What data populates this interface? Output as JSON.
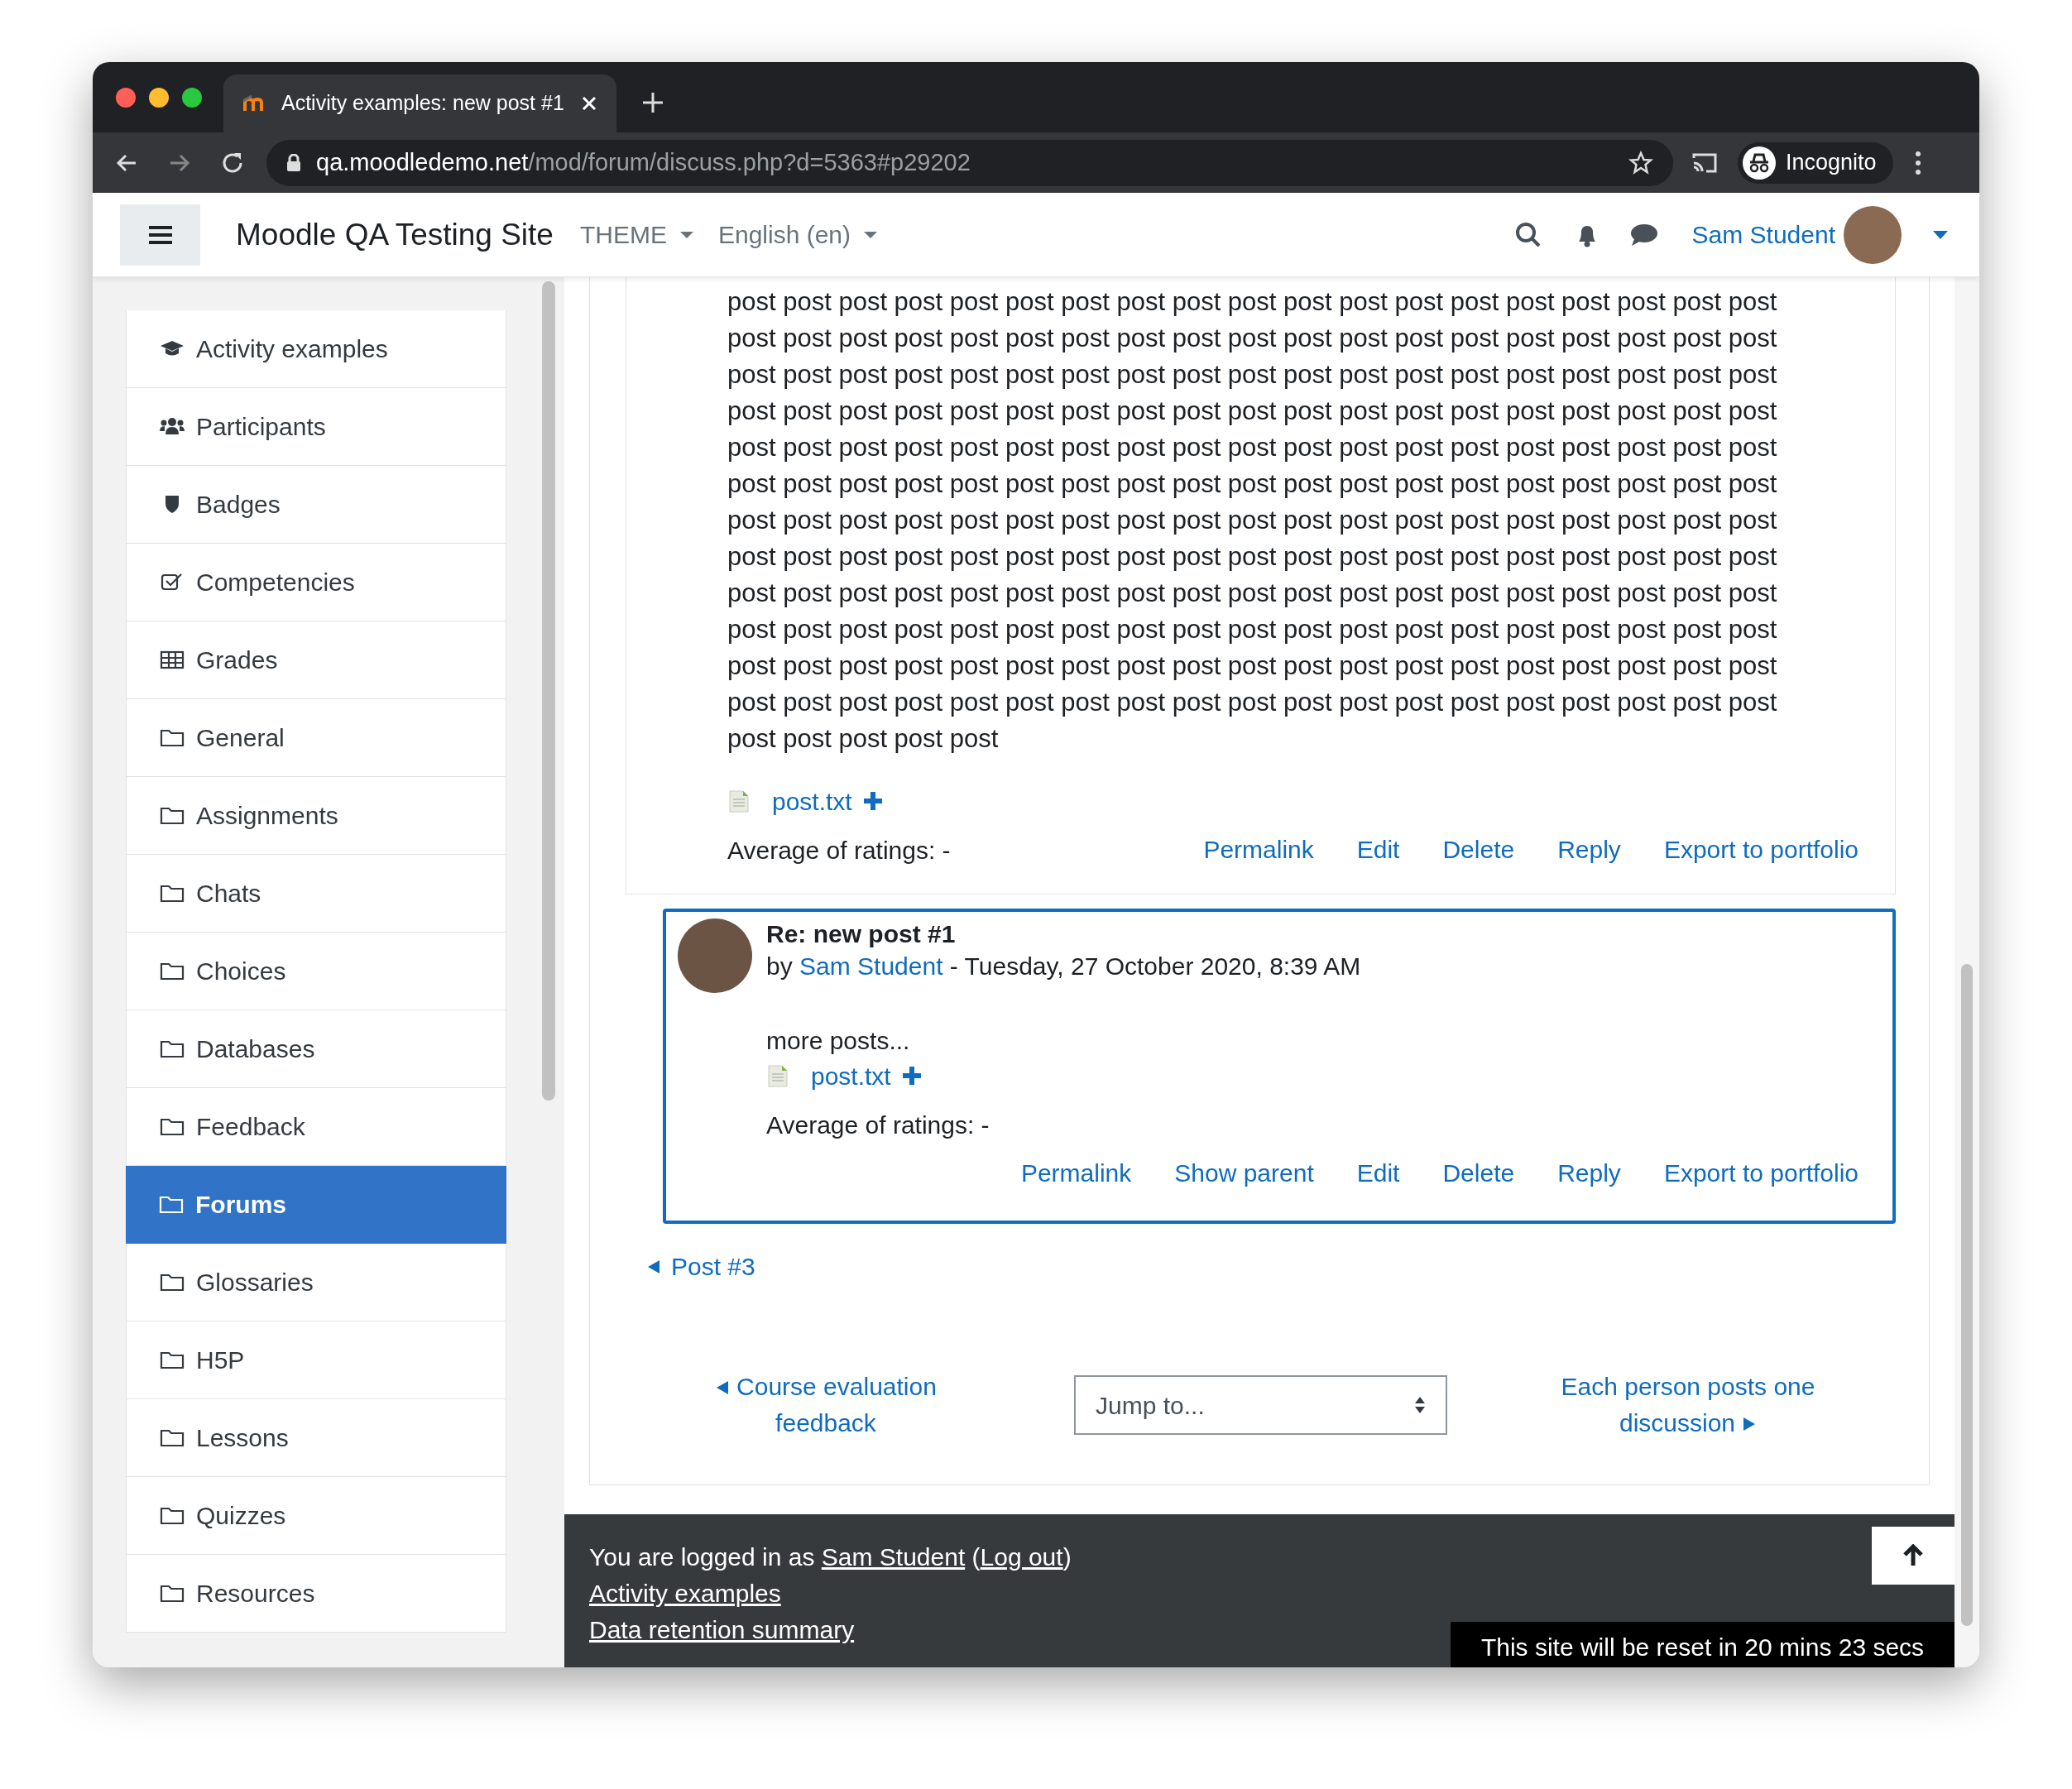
{
  "browser": {
    "tab_title": "Activity examples: new post #1",
    "url_host": "qa.moodledemo.net",
    "url_path": "/mod/forum/discuss.php?d=5363#p29202",
    "profile_label": "Incognito"
  },
  "navbar": {
    "site_name": "Moodle QA Testing Site",
    "menus": [
      "THEME",
      "English (en)"
    ],
    "user_name": "Sam Student"
  },
  "sidebar": {
    "items": [
      {
        "label": "Activity examples",
        "kind": "cap",
        "selected": false
      },
      {
        "label": "Participants",
        "kind": "users",
        "selected": false
      },
      {
        "label": "Badges",
        "kind": "shield",
        "selected": false
      },
      {
        "label": "Competencies",
        "kind": "check",
        "selected": false
      },
      {
        "label": "Grades",
        "kind": "table",
        "selected": false
      },
      {
        "label": "General",
        "kind": "folder",
        "selected": false
      },
      {
        "label": "Assignments",
        "kind": "folder",
        "selected": false
      },
      {
        "label": "Chats",
        "kind": "folder",
        "selected": false
      },
      {
        "label": "Choices",
        "kind": "folder",
        "selected": false
      },
      {
        "label": "Databases",
        "kind": "folder",
        "selected": false
      },
      {
        "label": "Feedback",
        "kind": "folder",
        "selected": false
      },
      {
        "label": "Forums",
        "kind": "folder",
        "selected": true
      },
      {
        "label": "Glossaries",
        "kind": "folder",
        "selected": false
      },
      {
        "label": "H5P",
        "kind": "folder",
        "selected": false
      },
      {
        "label": "Lessons",
        "kind": "folder",
        "selected": false
      },
      {
        "label": "Quizzes",
        "kind": "folder",
        "selected": false
      },
      {
        "label": "Resources",
        "kind": "folder",
        "selected": false
      }
    ]
  },
  "post": {
    "body": "post post post post post post post post post post post post post post post post post post post post post post post post post post post post post post post post post post post post post post post post post post post post post post post post post post post post post post post post post post post post post post post post post post post post post post post post post post post post post post post post post post post post post post post post post post post post post post post post post post post post post post post post post post post post post post post post post post post post post post post post post post post post post post post post post post post post post post post post post post post post post post post post post post post post post post post post post post post post post post post post post post post post post post post post post post post post post post post post post post post post post post post post post post post post post post post post post post post post post post post post post post post post post post post post post post post post post post post post post post post post post post post post post post post post post post post post post",
    "attachment": "post.txt",
    "rating": "Average of ratings: -",
    "actions": [
      "Permalink",
      "Edit",
      "Delete",
      "Reply",
      "Export to portfolio"
    ]
  },
  "reply": {
    "title": "Re: new post #1",
    "by": "by",
    "author": "Sam Student",
    "date": "- Tuesday, 27 October 2020, 8:39 AM",
    "body": "more posts...",
    "attachment": "post.txt",
    "rating": "Average of ratings: -",
    "actions": [
      "Permalink",
      "Show parent",
      "Edit",
      "Delete",
      "Reply",
      "Export to portfolio"
    ]
  },
  "discussion_nav": {
    "prev_post": "Post #3",
    "prev_discussion": "Course evaluation feedback",
    "jump_placeholder": "Jump to...",
    "next_discussion": "Each person posts one discussion"
  },
  "footer": {
    "prefix": "You are logged in as",
    "user": "Sam Student",
    "open_paren": "(",
    "logout": "Log out",
    "close_paren": ")",
    "links": [
      "Activity examples",
      "Data retention summary"
    ],
    "reset_notice": "This site will be reset in 20 mins 23 secs"
  }
}
